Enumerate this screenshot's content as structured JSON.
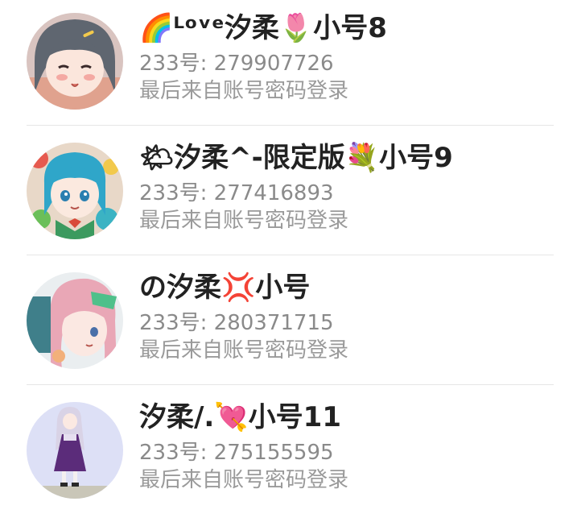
{
  "accounts": [
    {
      "name": "🌈ᴸᵒᵛᵉ汐柔🌷小号8",
      "id_line": "233号: 279907726",
      "login_source": "最后来自账号密码登录",
      "avatar_icon": "anime-girl-gray-hair-avatar"
    },
    {
      "name": "🌤汐柔^-限定版💐小号9",
      "id_line": "233号: 277416893",
      "login_source": "最后来自账号密码登录",
      "avatar_icon": "anime-girl-blue-hair-avatar"
    },
    {
      "name": "の汐柔💢小号",
      "id_line": "233号: 280371715",
      "login_source": "最后来自账号密码登录",
      "avatar_icon": "anime-girl-pink-hair-avatar"
    },
    {
      "name": "汐柔/.💘小号11",
      "id_line": "233号: 275155595",
      "login_source": "最后来自账号密码登录",
      "avatar_icon": "anime-girl-purple-dress-avatar"
    }
  ]
}
